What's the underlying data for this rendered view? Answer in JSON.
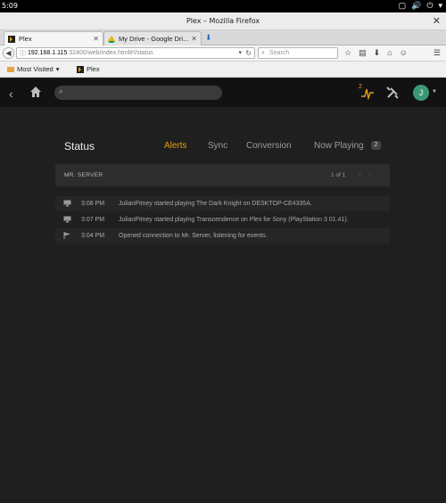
{
  "os_bar": {
    "clock": "5:09"
  },
  "window": {
    "title": "Plex – Mozilla Firefox"
  },
  "tabs": [
    {
      "label": "Plex",
      "active": true
    },
    {
      "label": "My Drive - Google Dri...",
      "active": false
    }
  ],
  "nav": {
    "url_host": "192.168.1.115",
    "url_rest": ":32400/web/index.html#!/status",
    "search_placeholder": "Search"
  },
  "bookmarks": [
    {
      "label": "Most Visited"
    },
    {
      "label": "Plex"
    }
  ],
  "plex_header": {
    "activity_count": "2",
    "avatar_initial": "J"
  },
  "status_page": {
    "title": "Status",
    "tabs": [
      {
        "label": "Alerts",
        "active": true
      },
      {
        "label": "Sync",
        "active": false
      },
      {
        "label": "Conversion",
        "active": false
      },
      {
        "label": "Now Playing",
        "active": false
      }
    ],
    "now_playing_count": "2",
    "server_name": "MR. SERVER",
    "pager": "1 of 1",
    "entries": [
      {
        "icon": "monitor-icon",
        "time": "3:08 PM",
        "message": "JulianPitney started playing The Dark Knight on DESKTOP-CE4335A."
      },
      {
        "icon": "monitor-icon",
        "time": "3:07 PM",
        "message": "JulianPitney started playing Transcendence on Plex for Sony (PlayStation 3 01.41)."
      },
      {
        "icon": "flag-icon",
        "time": "3:04 PM",
        "message": "Opened connection to Mr. Server, listening for events."
      }
    ]
  },
  "colors": {
    "accent": "#e5a00d",
    "background": "#1f1f1f",
    "header": "#121212",
    "avatar": "#3b9a75"
  }
}
